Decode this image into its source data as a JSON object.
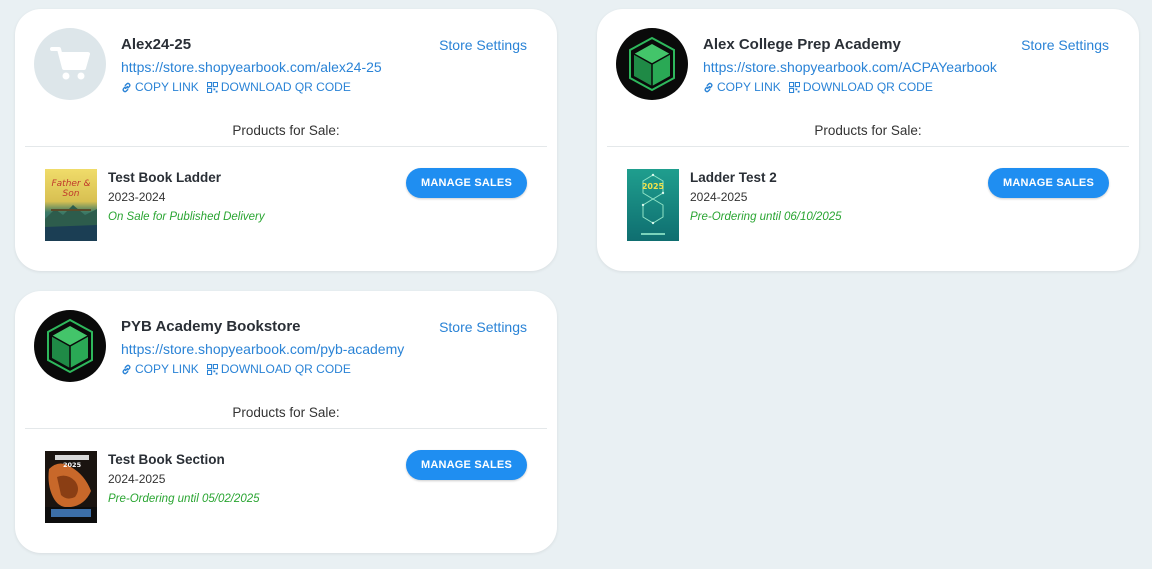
{
  "stores": [
    {
      "name": "Alex24-25",
      "url": "https://store.shopyearbook.com/alex24-25",
      "settings_label": "Store Settings",
      "copy_link_label": "COPY LINK",
      "qr_label": "DOWNLOAD QR CODE",
      "products_heading": "Products for Sale:",
      "avatar_icon": "shopping-cart-icon",
      "product": {
        "title": "Test Book Ladder",
        "year": "2023-2024",
        "status": "On Sale for Published Delivery",
        "button_label": "MANAGE SALES",
        "cover_text": "Father & Son"
      }
    },
    {
      "name": "Alex College Prep Academy",
      "url": "https://store.shopyearbook.com/ACPAYearbook",
      "settings_label": "Store Settings",
      "copy_link_label": "COPY LINK",
      "qr_label": "DOWNLOAD QR CODE",
      "products_heading": "Products for Sale:",
      "avatar_icon": "green-cube-logo-icon",
      "product": {
        "title": "Ladder Test 2",
        "year": "2024-2025",
        "status": "Pre-Ordering until 06/10/2025",
        "button_label": "MANAGE SALES",
        "cover_text": "2025"
      }
    },
    {
      "name": "PYB Academy Bookstore",
      "url": "https://store.shopyearbook.com/pyb-academy",
      "settings_label": "Store Settings",
      "copy_link_label": "COPY LINK",
      "qr_label": "DOWNLOAD QR CODE",
      "products_heading": "Products for Sale:",
      "avatar_icon": "green-cube-logo-icon",
      "product": {
        "title": "Test Book Section",
        "year": "2024-2025",
        "status": "Pre-Ordering until 05/02/2025",
        "button_label": "MANAGE SALES",
        "cover_text": "2025"
      }
    }
  ],
  "colors": {
    "background": "#e9f0f3",
    "link": "#2a83d6",
    "button": "#1f8ef1",
    "status_green": "#2aa532"
  }
}
